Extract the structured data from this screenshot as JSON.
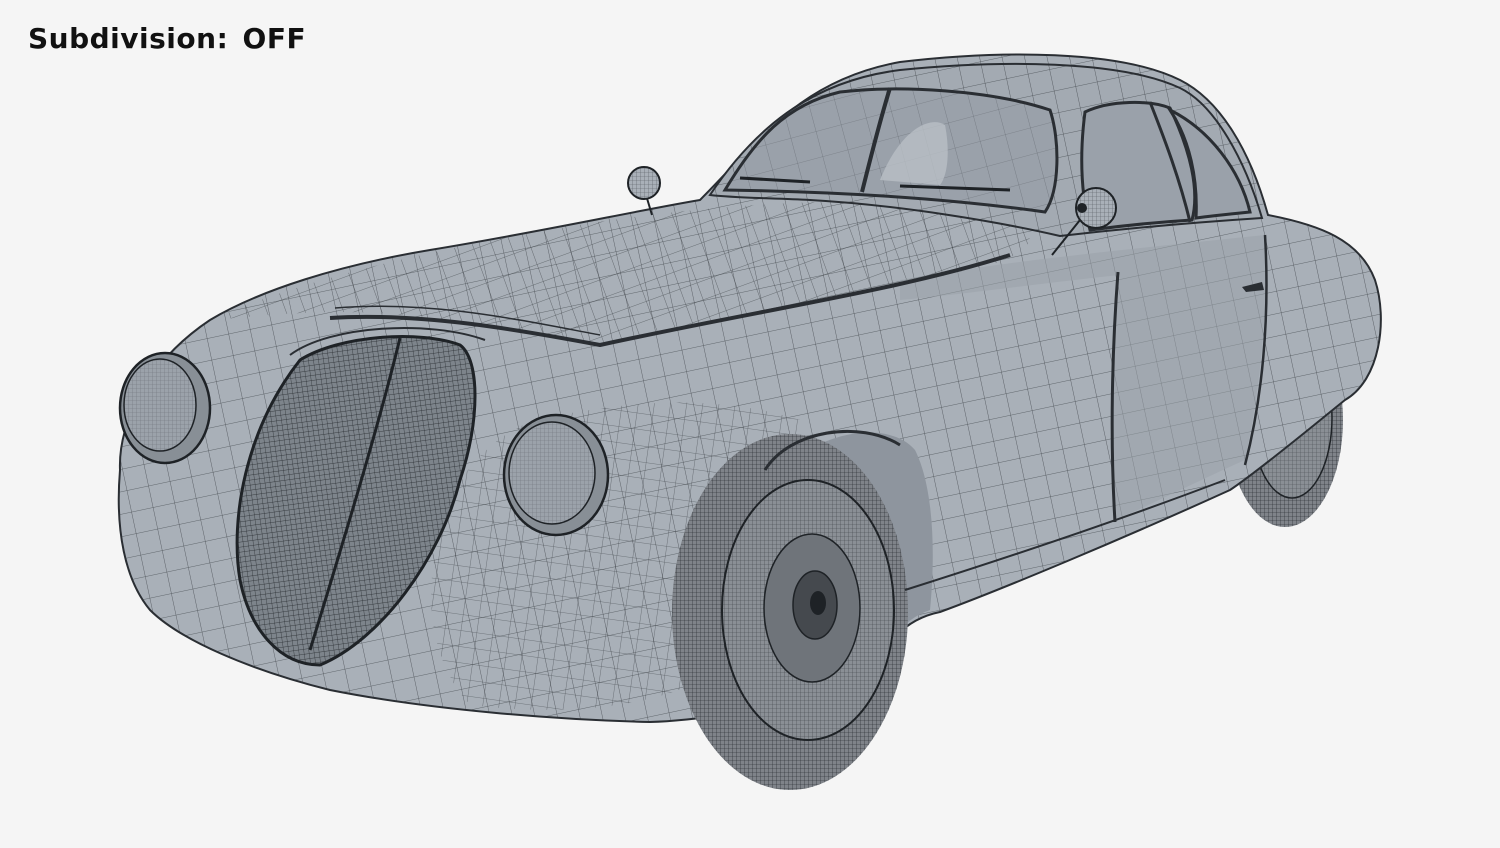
{
  "viewport": {
    "caption_label": "Subdivision:",
    "caption_value": "OFF"
  },
  "scene": {
    "subject": "car-wireframe-render",
    "colors": {
      "background": "#f5f5f5",
      "body_fill": "#a9b0b8",
      "body_shade": "#8e959e",
      "glass_fill": "#9aa1aa",
      "wire": "#2a2e33",
      "tire": "#7f8389",
      "caption": "#111111"
    }
  }
}
